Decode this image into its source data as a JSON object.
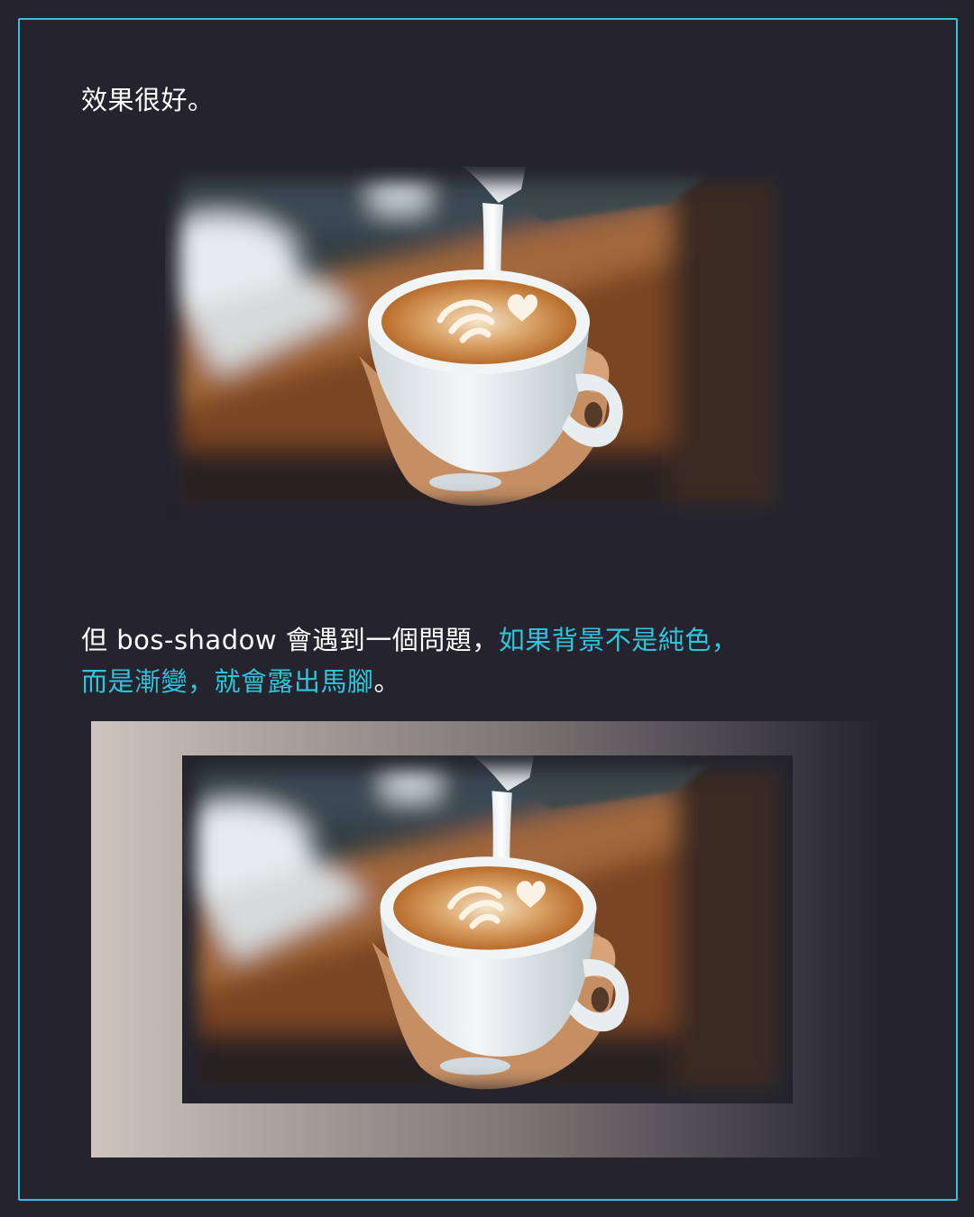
{
  "section1": {
    "text": "效果很好。"
  },
  "section2": {
    "text_plain": "但 bos-shadow 會遇到一個問題，",
    "text_highlight_1": "如果背景不是純色，",
    "text_highlight_2": "而是漸變，就會露出馬腳",
    "text_end": "。"
  },
  "colors": {
    "background": "#24232e",
    "accent": "#2ec6dc",
    "text": "#ffffff"
  }
}
